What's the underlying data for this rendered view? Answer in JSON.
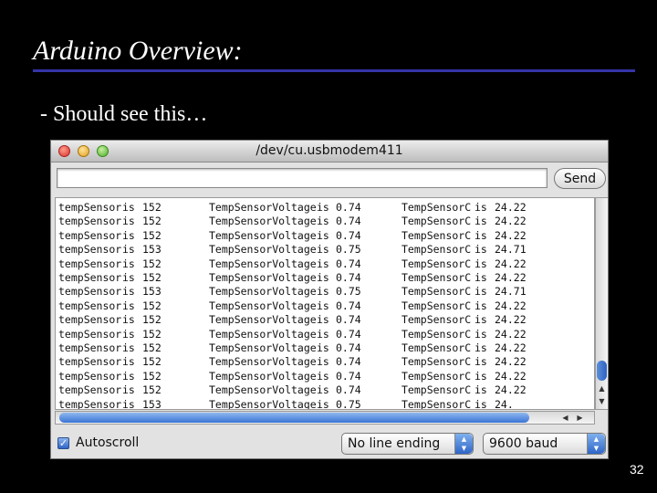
{
  "slide": {
    "title": "Arduino Overview:",
    "bullet": "- Should see this…",
    "page_number": "32"
  },
  "window": {
    "title": "/dev/cu.usbmodem411",
    "send_label": "Send",
    "send_value": "",
    "autoscroll_label": "Autoscroll",
    "autoscroll_checked": true,
    "line_ending": "No line ending",
    "baud": "9600 baud"
  },
  "serial_output": {
    "rows": [
      {
        "label1": "tempSensor",
        "is1": "is",
        "raw": "152",
        "label2": "TempSensorVoltage",
        "is2": "is",
        "voltage": "0.74",
        "label3": "TempSensorC",
        "is3": "is",
        "celsius": "24.22"
      },
      {
        "label1": "tempSensor",
        "is1": "is",
        "raw": "152",
        "label2": "TempSensorVoltage",
        "is2": "is",
        "voltage": "0.74",
        "label3": "TempSensorC",
        "is3": "is",
        "celsius": "24.22"
      },
      {
        "label1": "tempSensor",
        "is1": "is",
        "raw": "152",
        "label2": "TempSensorVoltage",
        "is2": "is",
        "voltage": "0.74",
        "label3": "TempSensorC",
        "is3": "is",
        "celsius": "24.22"
      },
      {
        "label1": "tempSensor",
        "is1": "is",
        "raw": "153",
        "label2": "TempSensorVoltage",
        "is2": "is",
        "voltage": "0.75",
        "label3": "TempSensorC",
        "is3": "is",
        "celsius": "24.71"
      },
      {
        "label1": "tempSensor",
        "is1": "is",
        "raw": "152",
        "label2": "TempSensorVoltage",
        "is2": "is",
        "voltage": "0.74",
        "label3": "TempSensorC",
        "is3": "is",
        "celsius": "24.22"
      },
      {
        "label1": "tempSensor",
        "is1": "is",
        "raw": "152",
        "label2": "TempSensorVoltage",
        "is2": "is",
        "voltage": "0.74",
        "label3": "TempSensorC",
        "is3": "is",
        "celsius": "24.22"
      },
      {
        "label1": "tempSensor",
        "is1": "is",
        "raw": "153",
        "label2": "TempSensorVoltage",
        "is2": "is",
        "voltage": "0.75",
        "label3": "TempSensorC",
        "is3": "is",
        "celsius": "24.71"
      },
      {
        "label1": "tempSensor",
        "is1": "is",
        "raw": "152",
        "label2": "TempSensorVoltage",
        "is2": "is",
        "voltage": "0.74",
        "label3": "TempSensorC",
        "is3": "is",
        "celsius": "24.22"
      },
      {
        "label1": "tempSensor",
        "is1": "is",
        "raw": "152",
        "label2": "TempSensorVoltage",
        "is2": "is",
        "voltage": "0.74",
        "label3": "TempSensorC",
        "is3": "is",
        "celsius": "24.22"
      },
      {
        "label1": "tempSensor",
        "is1": "is",
        "raw": "152",
        "label2": "TempSensorVoltage",
        "is2": "is",
        "voltage": "0.74",
        "label3": "TempSensorC",
        "is3": "is",
        "celsius": "24.22"
      },
      {
        "label1": "tempSensor",
        "is1": "is",
        "raw": "152",
        "label2": "TempSensorVoltage",
        "is2": "is",
        "voltage": "0.74",
        "label3": "TempSensorC",
        "is3": "is",
        "celsius": "24.22"
      },
      {
        "label1": "tempSensor",
        "is1": "is",
        "raw": "152",
        "label2": "TempSensorVoltage",
        "is2": "is",
        "voltage": "0.74",
        "label3": "TempSensorC",
        "is3": "is",
        "celsius": "24.22"
      },
      {
        "label1": "tempSensor",
        "is1": "is",
        "raw": "152",
        "label2": "TempSensorVoltage",
        "is2": "is",
        "voltage": "0.74",
        "label3": "TempSensorC",
        "is3": "is",
        "celsius": "24.22"
      },
      {
        "label1": "tempSensor",
        "is1": "is",
        "raw": "152",
        "label2": "TempSensorVoltage",
        "is2": "is",
        "voltage": "0.74",
        "label3": "TempSensorC",
        "is3": "is",
        "celsius": "24.22"
      },
      {
        "label1": "tempSensor",
        "is1": "is",
        "raw": "153",
        "label2": "TempSensorVoltage",
        "is2": "is",
        "voltage": "0.75",
        "label3": "TempSensorC",
        "is3": "is",
        "celsius": "24."
      }
    ]
  },
  "icons": {
    "close": "red-close-icon",
    "minimize": "yellow-minimize-icon",
    "zoom": "green-zoom-icon",
    "scroll_up": "arrow-up-icon",
    "scroll_down": "arrow-down-icon",
    "scroll_left": "arrow-left-icon",
    "scroll_right": "arrow-right-icon",
    "select_arrows": "up-down-arrows-icon"
  },
  "colors": {
    "slide_background": "#000000",
    "title_rule": "#3434a8",
    "scroll_thumb": "#3a74d4"
  }
}
